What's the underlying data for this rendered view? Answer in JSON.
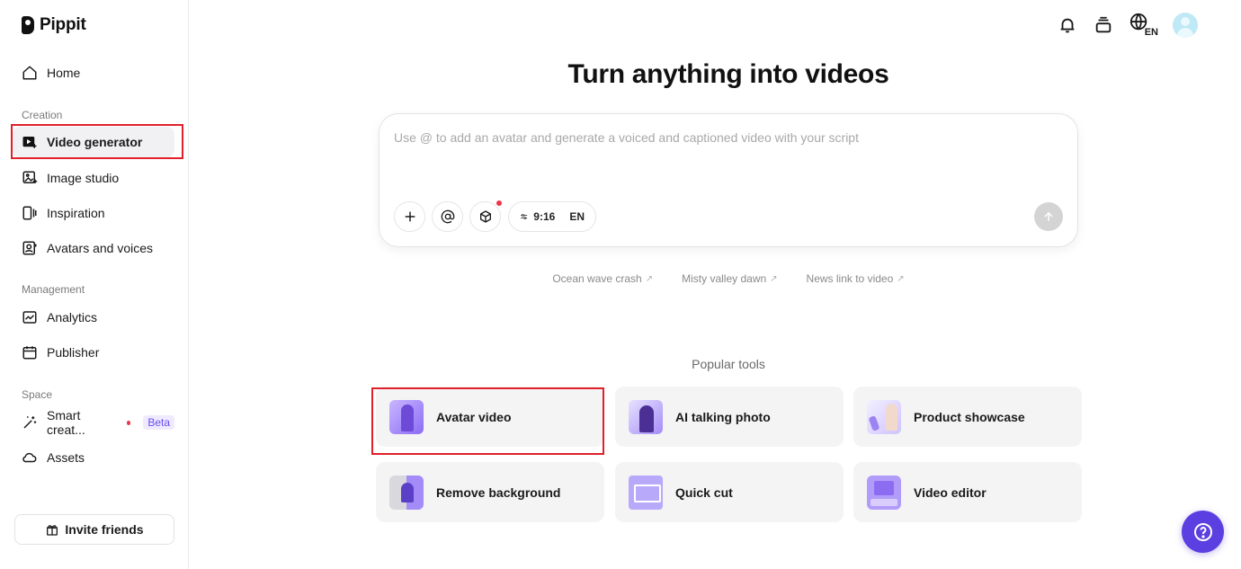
{
  "app": {
    "name": "Pippit"
  },
  "sidebar": {
    "home": "Home",
    "sections": {
      "creation": "Creation",
      "management": "Management",
      "space": "Space"
    },
    "items": [
      {
        "label": "Video generator",
        "icon": "video-generator-icon",
        "active": true
      },
      {
        "label": "Image studio",
        "icon": "image-studio-icon"
      },
      {
        "label": "Inspiration",
        "icon": "inspiration-icon"
      },
      {
        "label": "Avatars and voices",
        "icon": "avatar-icon"
      },
      {
        "label": "Analytics",
        "icon": "analytics-icon"
      },
      {
        "label": "Publisher",
        "icon": "calendar-icon"
      },
      {
        "label": "Smart creat...",
        "icon": "magic-wand-icon",
        "badge": "Beta"
      },
      {
        "label": "Assets",
        "icon": "cloud-icon"
      }
    ],
    "invite": "Invite friends"
  },
  "topbar": {
    "language": "EN"
  },
  "main": {
    "headline": "Turn anything into videos",
    "prompt": {
      "placeholder": "Use @ to add an avatar and generate a voiced and captioned video with your script",
      "value": "",
      "ratio": "9:16",
      "language": "EN"
    },
    "suggestions": [
      "Ocean wave crash",
      "Misty valley dawn",
      "News link to video"
    ],
    "popular_label": "Popular tools",
    "tools": [
      {
        "label": "Avatar video"
      },
      {
        "label": "AI talking photo"
      },
      {
        "label": "Product showcase"
      },
      {
        "label": "Remove background"
      },
      {
        "label": "Quick cut"
      },
      {
        "label": "Video editor"
      }
    ]
  },
  "colors": {
    "accent": "#5b3fe0",
    "highlight": "#e0202a",
    "tool_bg": "#f4f4f5"
  }
}
